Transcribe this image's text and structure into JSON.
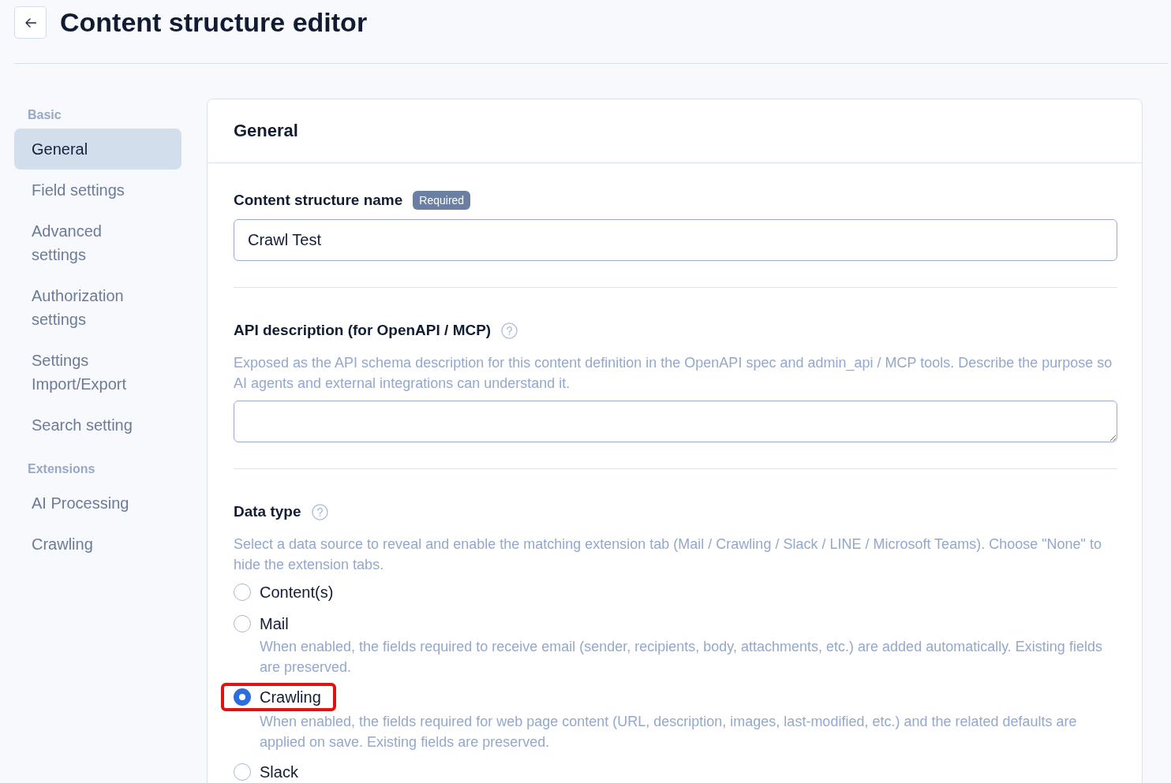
{
  "header": {
    "title": "Content structure editor"
  },
  "sidebar": {
    "groups": [
      {
        "label": "Basic",
        "items": [
          {
            "label": "General",
            "selected": true
          },
          {
            "label": "Field settings",
            "selected": false
          },
          {
            "label": "Advanced settings",
            "selected": false
          },
          {
            "label": "Authorization settings",
            "selected": false
          },
          {
            "label": "Settings Import/Export",
            "selected": false
          },
          {
            "label": "Search setting",
            "selected": false
          }
        ]
      },
      {
        "label": "Extensions",
        "items": [
          {
            "label": "AI Processing",
            "selected": false
          },
          {
            "label": "Crawling",
            "selected": false
          }
        ]
      }
    ]
  },
  "panel": {
    "title": "General",
    "sections": [
      {
        "kind": "text",
        "label": "Content structure name",
        "help": false,
        "badge": "Required",
        "value": "Crawl Test"
      },
      {
        "kind": "textarea",
        "label": "API description (for OpenAPI / MCP)",
        "help": true,
        "description": "Exposed as the API schema description for this content definition in the OpenAPI spec and admin_api / MCP tools. Describe the purpose so AI agents and external integrations can understand it."
      },
      {
        "kind": "radio",
        "label": "Data type",
        "help": true,
        "description": "Select a data source to reveal and enable the matching extension tab (Mail / Crawling / Slack / LINE / Microsoft Teams). Choose \"None\" to hide the extension tabs.",
        "options": [
          {
            "label": "Content(s)",
            "selected": false,
            "highlighted": false
          },
          {
            "label": "Mail",
            "selected": false,
            "highlighted": false,
            "description": "When enabled, the fields required to receive email (sender, recipients, body, attachments, etc.) are added automatically. Existing fields are preserved."
          },
          {
            "label": "Crawling",
            "selected": true,
            "highlighted": true,
            "description": "When enabled, the fields required for web page content (URL, description, images, last-modified, etc.) and the related defaults are applied on save. Existing fields are preserved."
          },
          {
            "label": "Slack",
            "selected": false,
            "highlighted": false
          }
        ]
      }
    ]
  }
}
